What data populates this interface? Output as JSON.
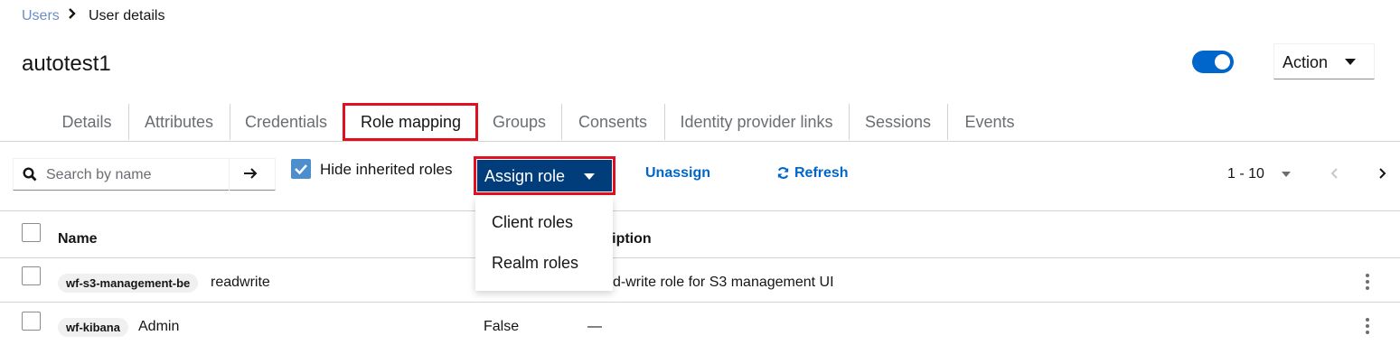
{
  "breadcrumb": {
    "parent": "Users",
    "current": "User details"
  },
  "page_title": "autotest1",
  "user_enabled": true,
  "action_label": "Action",
  "tabs": [
    {
      "label": "Details"
    },
    {
      "label": "Attributes"
    },
    {
      "label": "Credentials"
    },
    {
      "label": "Role mapping",
      "active": true
    },
    {
      "label": "Groups"
    },
    {
      "label": "Consents"
    },
    {
      "label": "Identity provider links"
    },
    {
      "label": "Sessions"
    },
    {
      "label": "Events"
    }
  ],
  "toolbar": {
    "search_placeholder": "Search by name",
    "hide_inherited_label": "Hide inherited roles",
    "hide_inherited_checked": true,
    "assign_label": "Assign role",
    "unassign_label": "Unassign",
    "refresh_label": "Refresh",
    "pagination": "1 - 10"
  },
  "assign_menu": [
    "Client roles",
    "Realm roles"
  ],
  "table": {
    "headers": {
      "name": "Name",
      "description": "cription"
    },
    "rows": [
      {
        "client": "wf-s3-management-be",
        "role": "readwrite",
        "inherited": "",
        "description": "d-write role for S3 management UI"
      },
      {
        "client": "wf-kibana",
        "role": "Admin",
        "inherited": "False",
        "description": "—"
      }
    ]
  },
  "colors": {
    "accent": "#0066cc",
    "assign_bg": "#003d7a",
    "highlight": "#e01020",
    "checkbox": "#4d8fcc"
  }
}
